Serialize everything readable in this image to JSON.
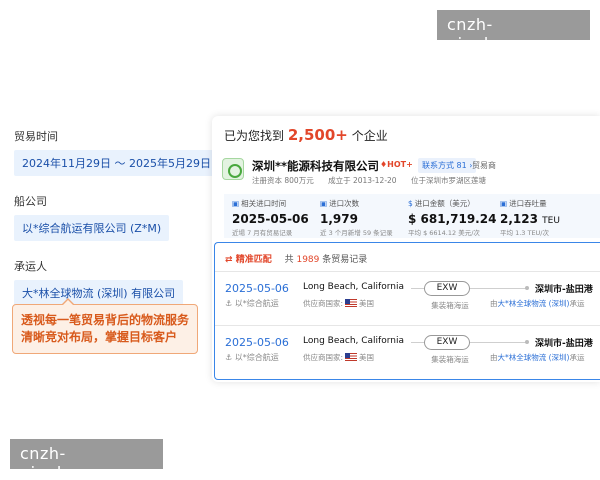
{
  "watermark": "cnzh-pingbo.com",
  "filters": {
    "trade_time_label": "贸易时间",
    "trade_time_value": "2024年11月29日 ～ 2025年5月29日",
    "shipping_company_label": "船公司",
    "shipping_company_value": "以*综合航运有限公司 (Z*M)",
    "carrier_label": "承运人",
    "carrier_value": "大*林全球物流 (深圳) 有限公司"
  },
  "callout": {
    "line1": "透视每一笔贸易背后的物流服务",
    "line2": "清晰竞对布局，掌握目标客户"
  },
  "results": {
    "prefix": "已为您找到",
    "count": "2,500+",
    "suffix": "个企业"
  },
  "company": {
    "name": "深圳**能源科技有限公司",
    "hot": "HOT+",
    "contact": "联系方式 81",
    "trade_type": "贸易商",
    "capital": "注册资本 800万元",
    "founded": "成立于 2013-12-20",
    "location": "位于深圳市罗湖区莲塘"
  },
  "stats": [
    {
      "label": "相关进口时间",
      "value": "2025-05-06",
      "unit": "",
      "sub": "近場 7 月有贸易记录"
    },
    {
      "label": "进口次数",
      "value": "1,979",
      "unit": "",
      "sub": "近 3 个月新增 59 条记录"
    },
    {
      "label": "进口金额（美元）",
      "value": "$ 681,719.24",
      "unit": "",
      "sub": "平均 $ 6614.12 美元/次"
    },
    {
      "label": "进口吞吐量",
      "value": "2,123",
      "unit": "TEU",
      "sub": "平均 1.3 TEU/次"
    }
  ],
  "records": {
    "match_label": "精准匹配",
    "total_prefix": "共",
    "total_count": "1989",
    "total_suffix": "条贸易记录",
    "rows": [
      {
        "date": "2025-05-06",
        "carrier": "以*综合航运",
        "origin": "Long Beach, California",
        "country_prefix": "供应商国家:",
        "country": "美国",
        "terms": "EXW",
        "mode": "集装箱海运",
        "destination": "深圳市-盐田港",
        "by_prefix": "由",
        "by_company": "大*林全球物流 (深圳)",
        "by_suffix": "承运"
      },
      {
        "date": "2025-05-06",
        "carrier": "以*综合航运",
        "origin": "Long Beach, California",
        "country_prefix": "供应商国家:",
        "country": "美国",
        "terms": "EXW",
        "mode": "集装箱海运",
        "destination": "深圳市-盐田港",
        "by_prefix": "由",
        "by_company": "大*林全球物流 (深圳)",
        "by_suffix": "承运"
      }
    ]
  },
  "icons": {
    "flag": "us-flag-icon",
    "logo": "company-logo",
    "ship": "ship-icon"
  }
}
